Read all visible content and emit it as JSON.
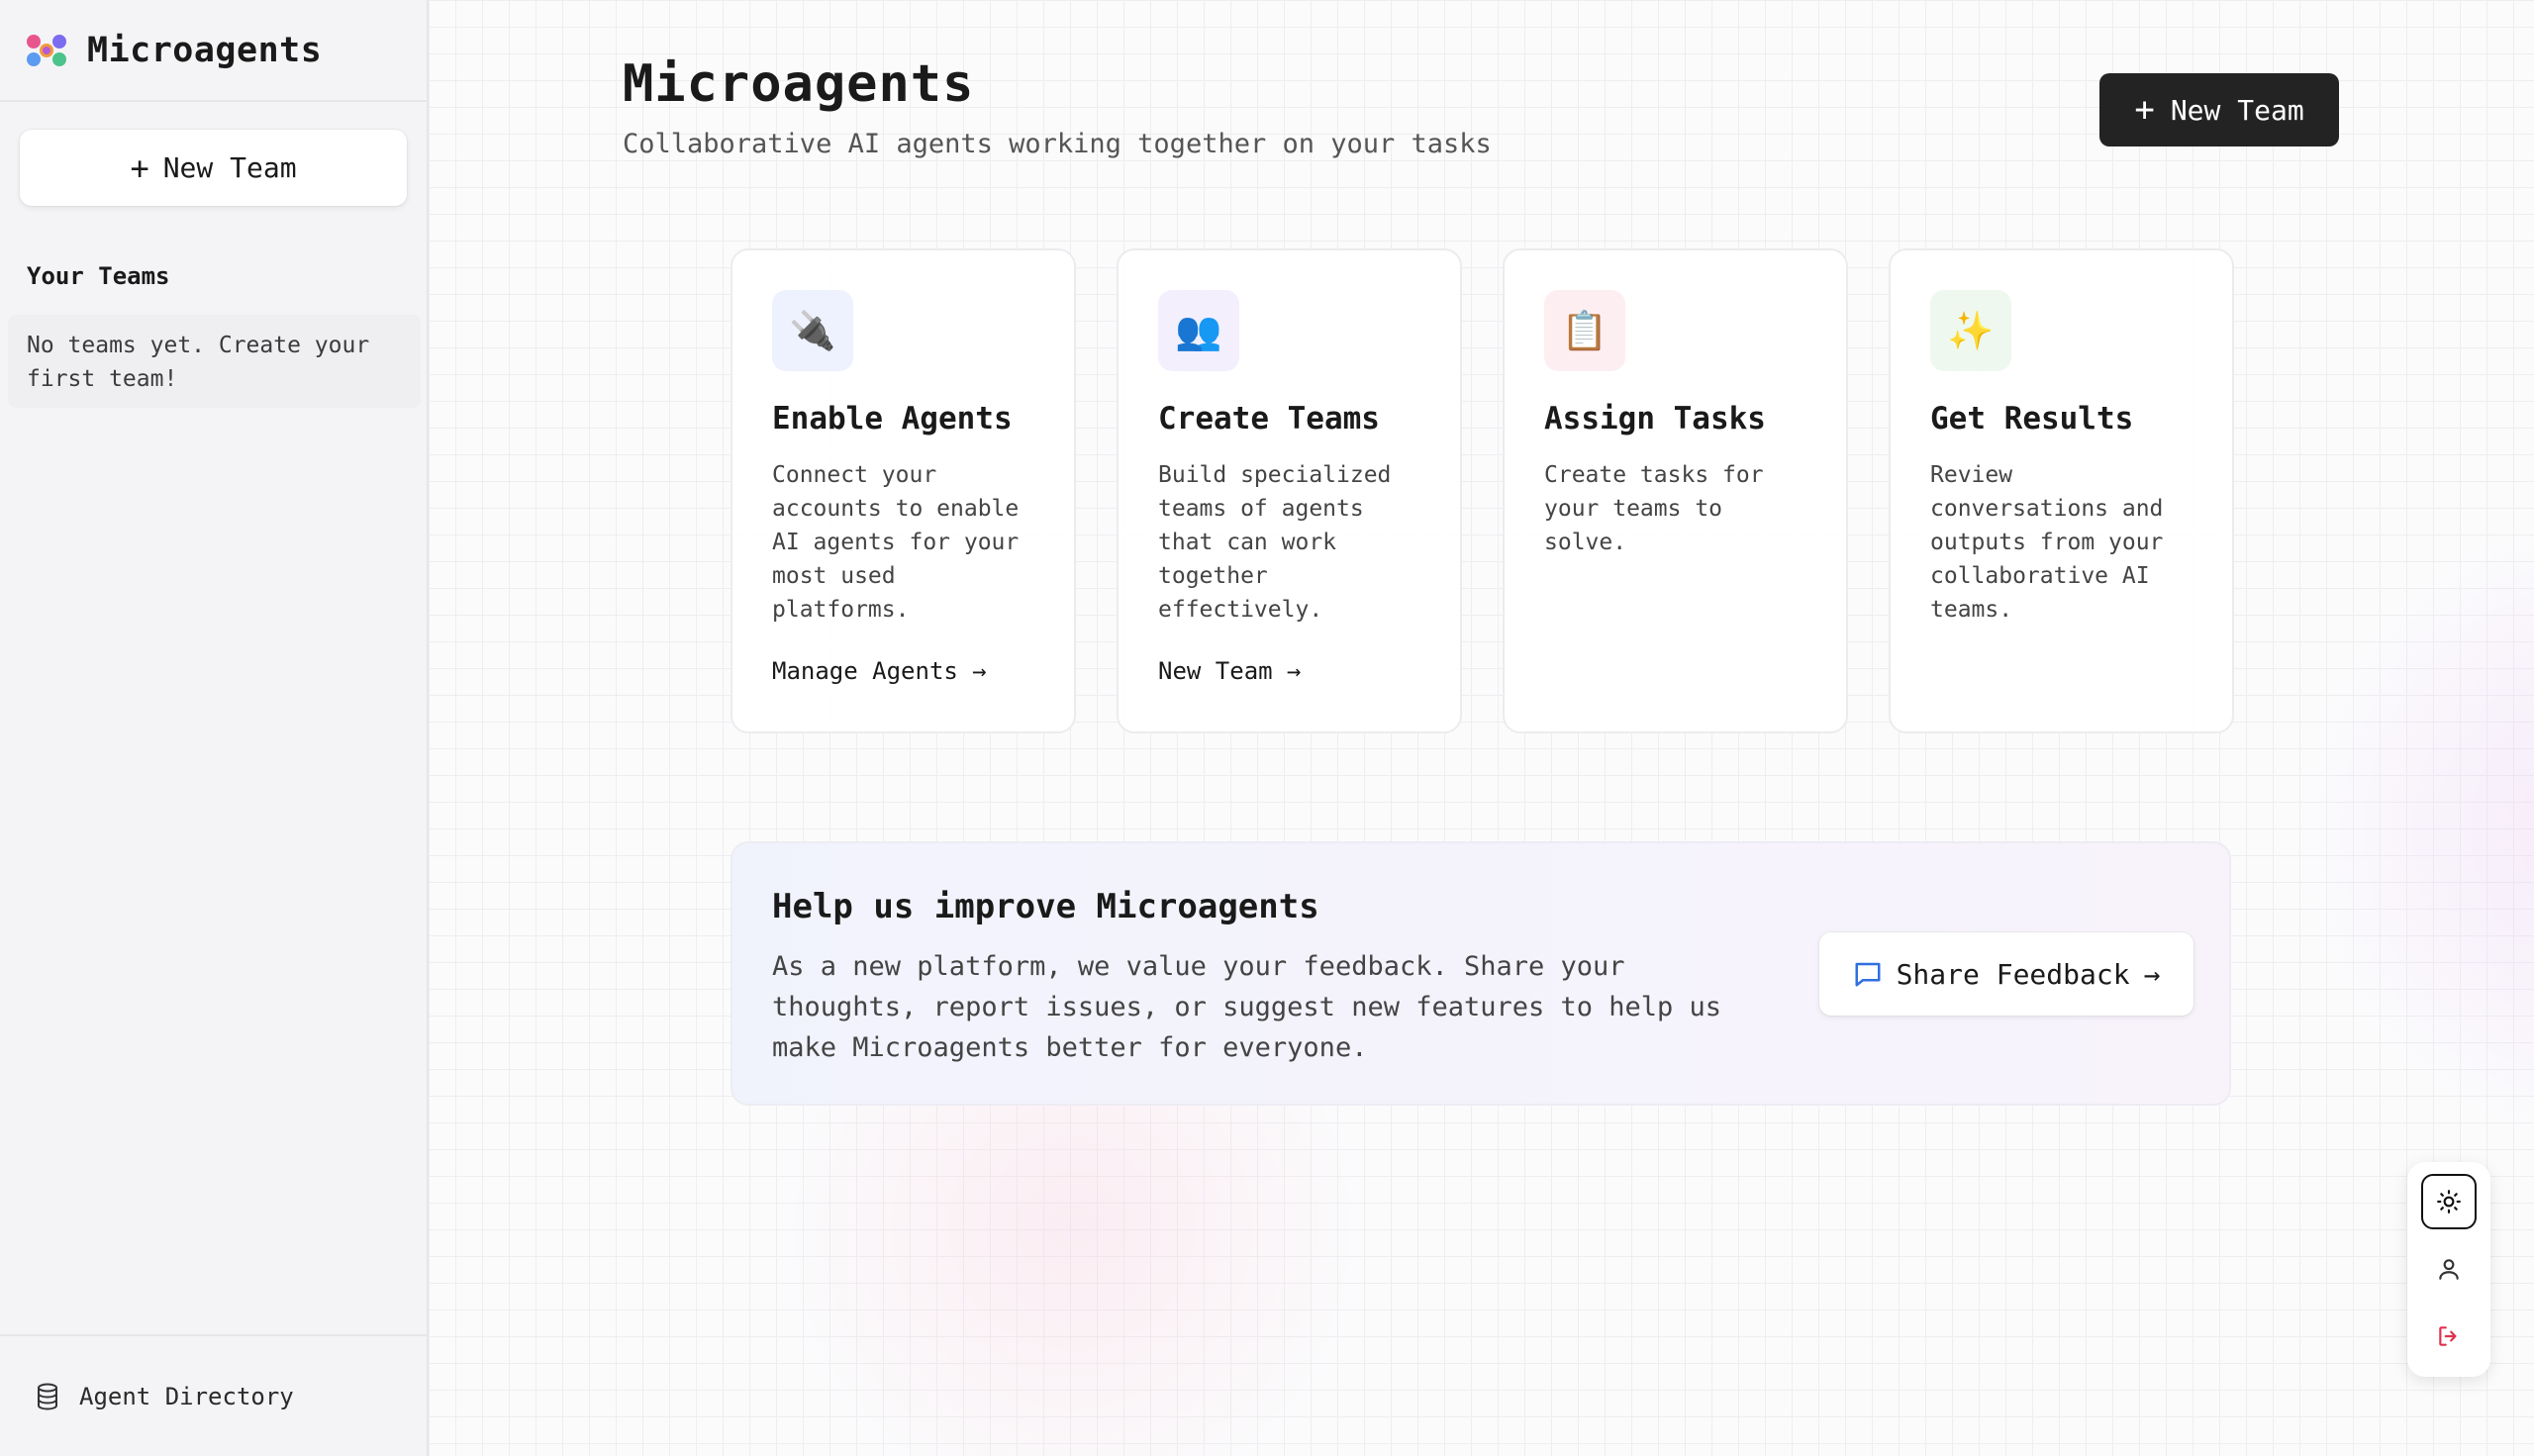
{
  "sidebar": {
    "app_name": "Microagents",
    "new_team_label": "New Team",
    "section_label": "Your Teams",
    "empty_message": "No teams yet. Create your first team!",
    "footer_link": "Agent Directory"
  },
  "header": {
    "title": "Microagents",
    "subtitle": "Collaborative AI agents working together on your tasks",
    "new_team_label": "New Team"
  },
  "cards": [
    {
      "icon": "🔌",
      "icon_name": "plug-icon",
      "icon_bg": "#eef2fe",
      "title": "Enable Agents",
      "text": "Connect your accounts to enable AI agents for your most used platforms.",
      "link": "Manage Agents →"
    },
    {
      "icon": "👥",
      "icon_name": "people-icon",
      "icon_bg": "#f3effd",
      "title": "Create Teams",
      "text": "Build specialized teams of agents that can work together effectively.",
      "link": "New Team →"
    },
    {
      "icon": "📋",
      "icon_name": "clipboard-icon",
      "icon_bg": "#fdeef1",
      "title": "Assign Tasks",
      "text": "Create tasks for your teams to solve.",
      "link": ""
    },
    {
      "icon": "✨",
      "icon_name": "sparkles-icon",
      "icon_bg": "#eef8ef",
      "title": "Get Results",
      "text": "Review conversations and outputs from your collaborative AI teams.",
      "link": ""
    }
  ],
  "feedback": {
    "title": "Help us improve Microagents",
    "text": "As a new platform, we value your feedback. Share your thoughts, report issues, or suggest new features to help us make Microagents better for everyone.",
    "button_label": "Share Feedback"
  },
  "floating_panel": {
    "icons": [
      "sun-icon",
      "user-icon",
      "logout-icon"
    ]
  },
  "colors": {
    "primary_button": "#232323",
    "logout": "#e0314b",
    "feedback_icon": "#2f6fe0"
  }
}
